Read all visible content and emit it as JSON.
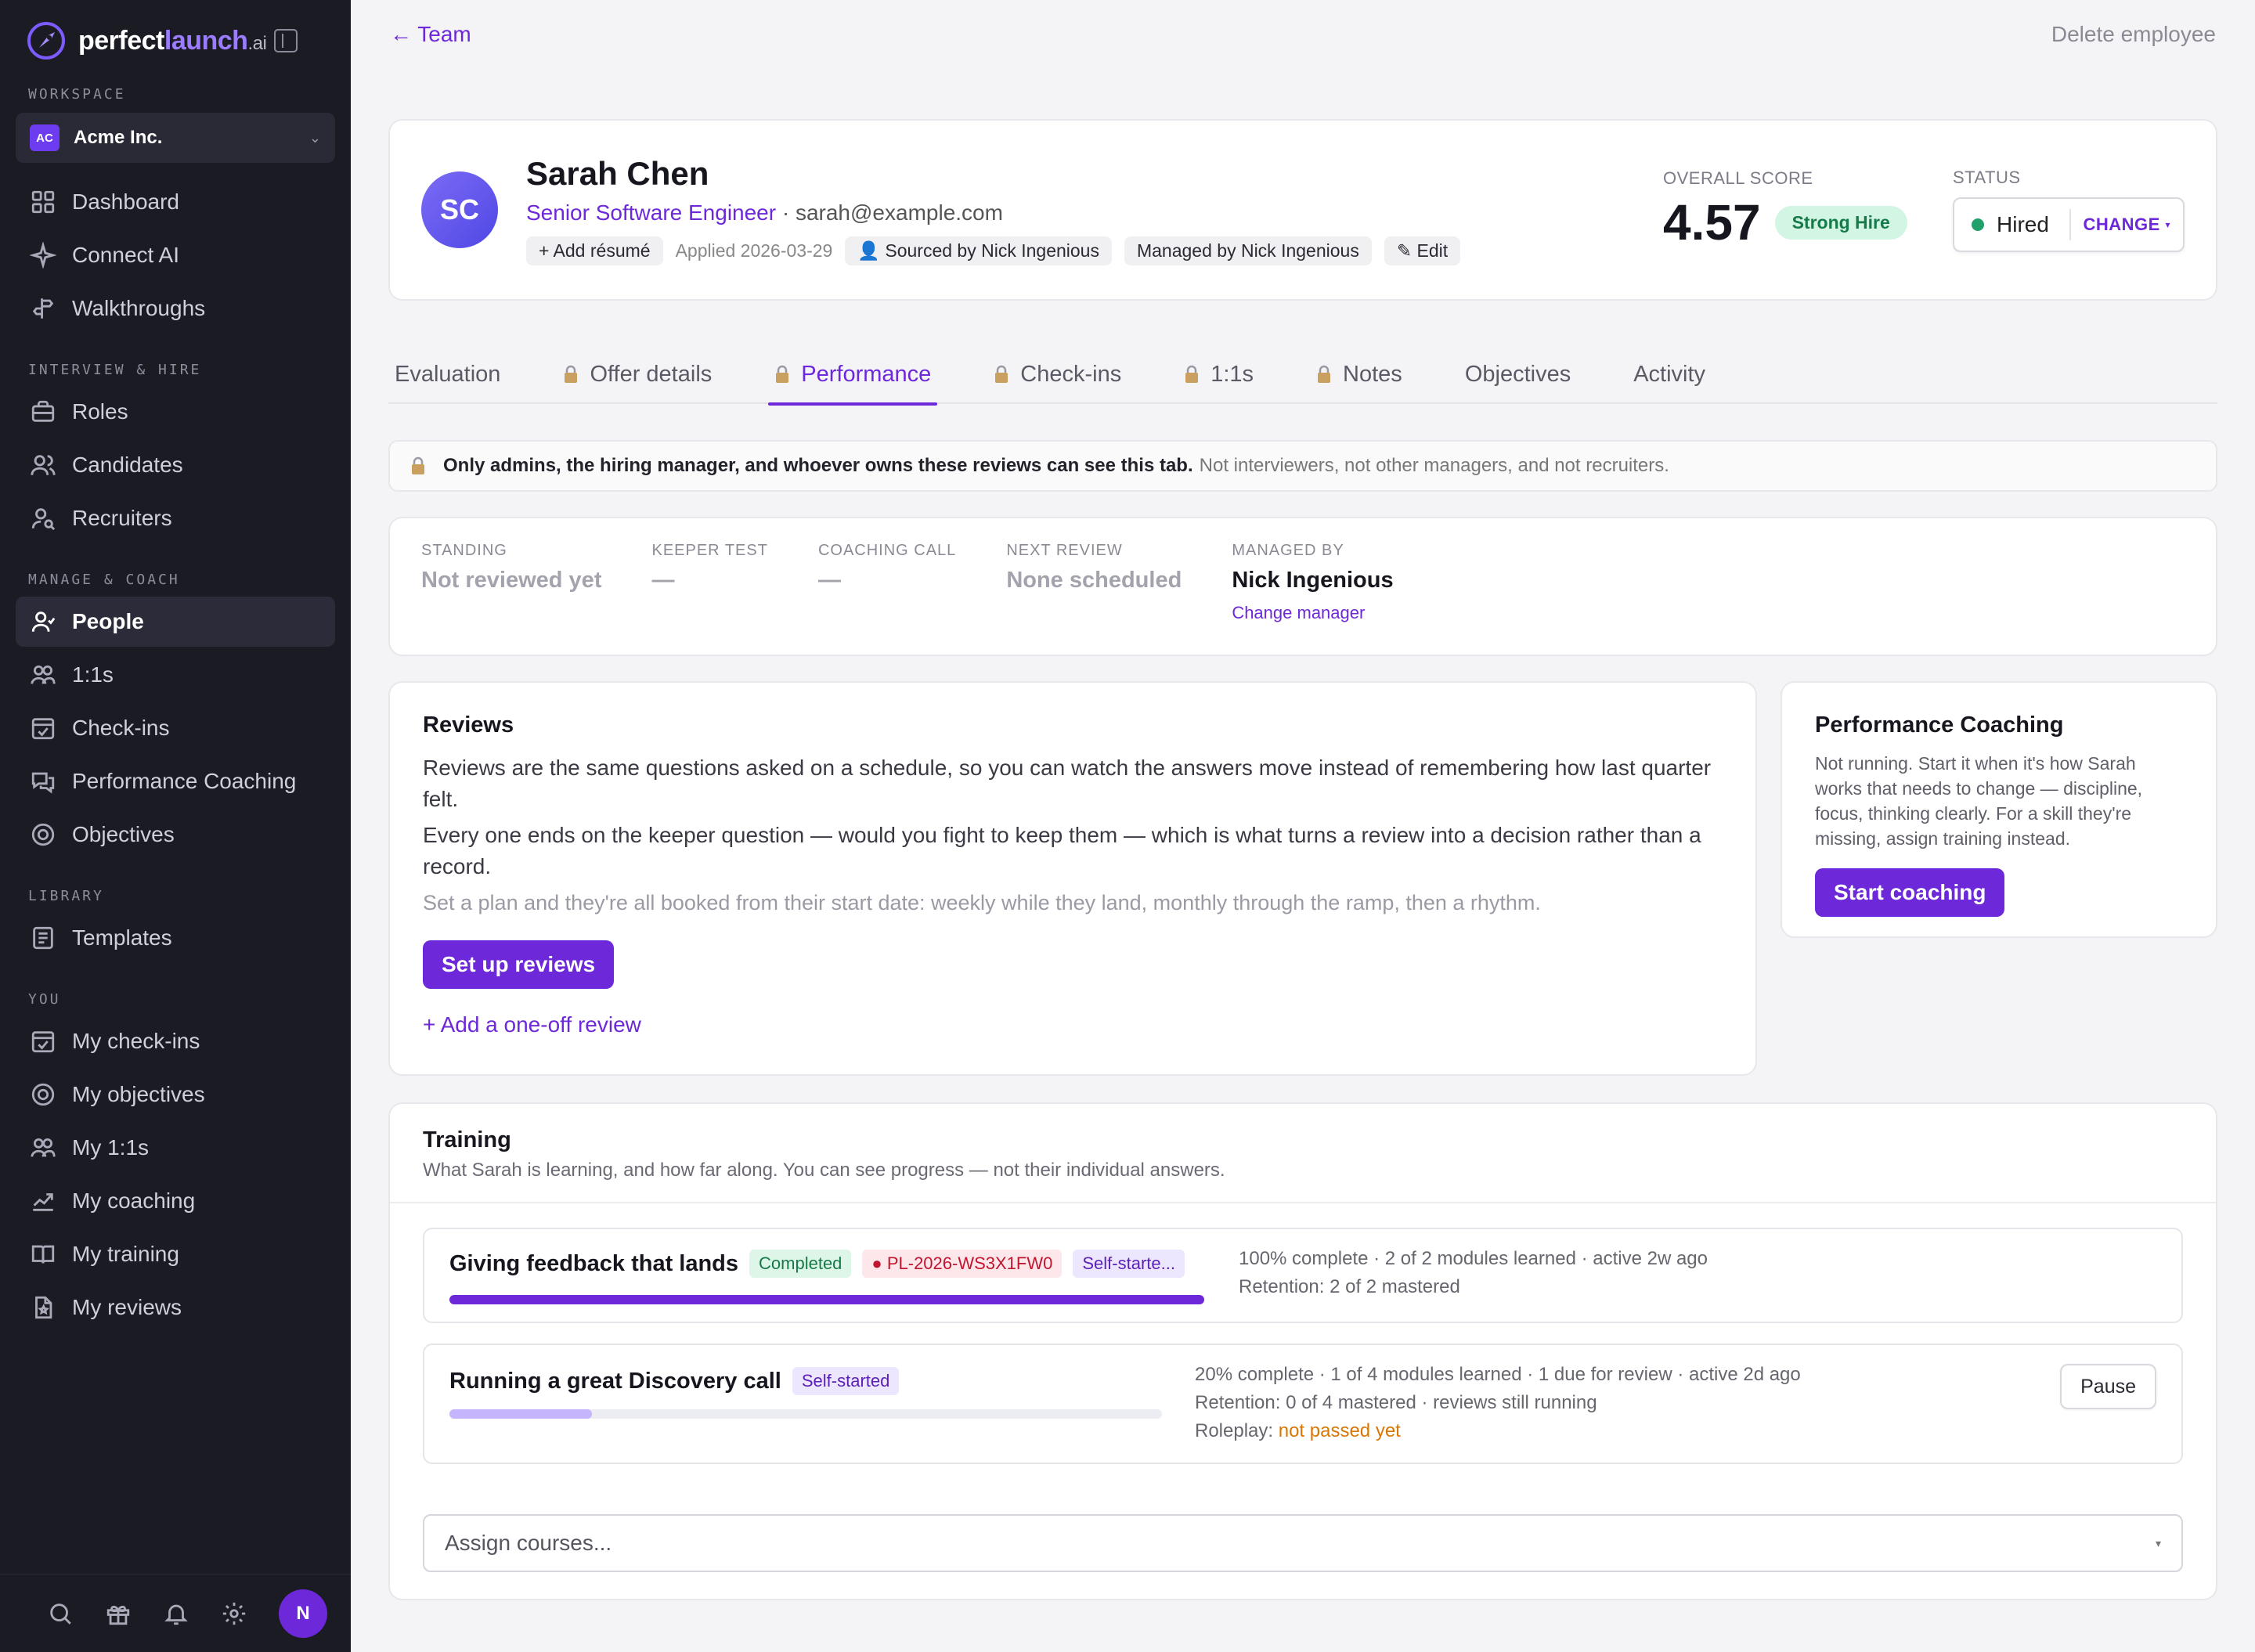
{
  "brand": {
    "name_main": "perfect",
    "name_accent": "launch",
    "name_tld": ".ai"
  },
  "sidebar": {
    "workspace_label": "WORKSPACE",
    "workspace": {
      "badge": "AC",
      "name": "Acme Inc."
    },
    "sections": [
      {
        "label": "",
        "items": [
          {
            "label": "Dashboard",
            "icon": "grid-icon"
          },
          {
            "label": "Connect AI",
            "icon": "sparkle-icon"
          },
          {
            "label": "Walkthroughs",
            "icon": "signpost-icon"
          }
        ]
      },
      {
        "label": "INTERVIEW & HIRE",
        "items": [
          {
            "label": "Roles",
            "icon": "briefcase-icon"
          },
          {
            "label": "Candidates",
            "icon": "users-icon"
          },
          {
            "label": "Recruiters",
            "icon": "user-search-icon"
          }
        ]
      },
      {
        "label": "MANAGE & COACH",
        "items": [
          {
            "label": "People",
            "icon": "user-icon",
            "active": true
          },
          {
            "label": "1:1s",
            "icon": "users-icon"
          },
          {
            "label": "Check-ins",
            "icon": "calendar-check-icon"
          },
          {
            "label": "Performance Coaching",
            "icon": "chat-icon"
          },
          {
            "label": "Objectives",
            "icon": "target-icon"
          }
        ]
      },
      {
        "label": "LIBRARY",
        "items": [
          {
            "label": "Templates",
            "icon": "document-icon"
          }
        ]
      },
      {
        "label": "YOU",
        "items": [
          {
            "label": "My check-ins",
            "icon": "calendar-check-icon"
          },
          {
            "label": "My objectives",
            "icon": "target-icon"
          },
          {
            "label": "My 1:1s",
            "icon": "users-icon"
          },
          {
            "label": "My coaching",
            "icon": "trend-icon"
          },
          {
            "label": "My training",
            "icon": "book-icon"
          },
          {
            "label": "My reviews",
            "icon": "file-star-icon"
          }
        ]
      }
    ],
    "footer": {
      "avatar_initial": "N"
    }
  },
  "topbar": {
    "back_label": "← Team",
    "delete_label": "Delete employee"
  },
  "employee": {
    "initials": "SC",
    "name": "Sarah Chen",
    "role": "Senior Software Engineer",
    "email": "· sarah@example.com",
    "add_resume": "+ Add résumé",
    "applied": "Applied 2026-03-29",
    "sourced_by": "Sourced by Nick Ingenious",
    "managed_by": "Managed by Nick Ingenious",
    "edit": "✎ Edit",
    "score_label": "OVERALL SCORE",
    "score": "4.57",
    "score_badge": "Strong Hire",
    "status_label": "STATUS",
    "status": "Hired",
    "status_change": "CHANGE",
    "colors": {
      "accent": "#6d28d9",
      "status_dot": "#22a06b",
      "strong_hire_bg": "#d3f5e3"
    }
  },
  "tabs": [
    {
      "label": "Evaluation",
      "locked": false
    },
    {
      "label": "Offer details",
      "locked": true
    },
    {
      "label": "Performance",
      "locked": true,
      "active": true
    },
    {
      "label": "Check-ins",
      "locked": true
    },
    {
      "label": "1:1s",
      "locked": true
    },
    {
      "label": "Notes",
      "locked": true
    },
    {
      "label": "Objectives",
      "locked": false
    },
    {
      "label": "Activity",
      "locked": false
    }
  ],
  "notice": {
    "bold": "Only admins, the hiring manager, and whoever owns these reviews can see this tab.",
    "rest": "Not interviewers, not other managers, and not recruiters."
  },
  "standing": {
    "cols": [
      {
        "key": "STANDING",
        "value": "Not reviewed yet"
      },
      {
        "key": "KEEPER TEST",
        "value": "—"
      },
      {
        "key": "COACHING CALL",
        "value": "—"
      },
      {
        "key": "NEXT REVIEW",
        "value": "None scheduled"
      },
      {
        "key": "MANAGED BY",
        "value": "Nick Ingenious",
        "link": "Change manager"
      }
    ]
  },
  "reviews": {
    "title": "Reviews",
    "p1": "Reviews are the same questions asked on a schedule, so you can watch the answers move instead of remembering how last quarter felt.",
    "p2": "Every one ends on the keeper question — would you fight to keep them — which is what turns a review into a decision rather than a record.",
    "p3": "Set a plan and they're all booked from their start date: weekly while they land, monthly through the ramp, then a rhythm.",
    "button": "Set up reviews",
    "add_link": "+ Add a one-off review"
  },
  "coaching": {
    "title": "Performance Coaching",
    "text": "Not running. Start it when it's how Sarah works that needs to change — discipline, focus, thinking clearly. For a skill they're missing, assign training instead.",
    "button": "Start coaching"
  },
  "training": {
    "title": "Training",
    "subtitle": "What Sarah is learning, and how far along. You can see progress — not their individual answers.",
    "courses": [
      {
        "title": "Giving feedback that lands",
        "badges": [
          "Completed",
          "PL-2026-WS3X1FW0",
          "Self-starte..."
        ],
        "progress": 1.0,
        "meta1": "100% complete · 2 of 2 modules learned · active 2w ago",
        "meta2": "Retention: 2 of 2 mastered"
      },
      {
        "title": "Running a great Discovery call",
        "badges": [
          "Self-started"
        ],
        "progress": 0.2,
        "meta1": "20% complete · 1 of 4 modules learned · 1 due for review · active 2d ago",
        "meta2": "Retention: 0 of 4 mastered · reviews still running",
        "meta3_prefix": "Roleplay:",
        "meta3_warn": "not passed yet",
        "action": "Pause"
      }
    ],
    "assign_placeholder": "Assign courses..."
  }
}
